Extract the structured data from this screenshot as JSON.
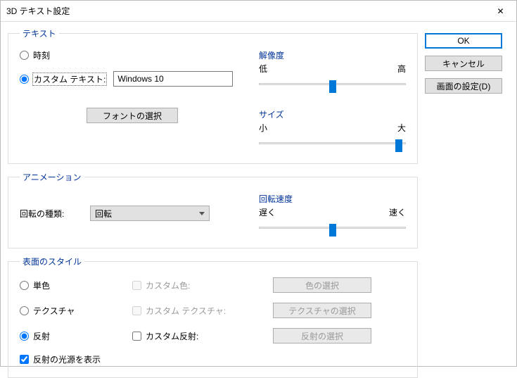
{
  "window": {
    "title": "3D テキスト設定"
  },
  "buttons": {
    "ok": "OK",
    "cancel": "キャンセル",
    "display": "画面の設定(D)"
  },
  "text_group": {
    "legend": "テキスト",
    "radio_time": "時刻",
    "radio_custom": "カスタム テキスト:",
    "custom_value": "Windows 10",
    "font_btn": "フォントの選択"
  },
  "sliders": {
    "resolution": {
      "title": "解像度",
      "low": "低",
      "high": "高",
      "value": 50
    },
    "size": {
      "title": "サイズ",
      "low": "小",
      "high": "大",
      "value": 95
    },
    "speed": {
      "title": "回転速度",
      "low": "遅く",
      "high": "速く",
      "value": 50
    }
  },
  "anim_group": {
    "legend": "アニメーション",
    "rotate_label": "回転の種類:",
    "rotate_value": "回転"
  },
  "style_group": {
    "legend": "表面のスタイル",
    "r_solid": "単色",
    "r_texture": "テクスチャ",
    "r_reflect": "反射",
    "c_color": "カスタム色:",
    "c_tex": "カスタム テクスチャ:",
    "c_ref": "カスタム反射:",
    "b_color": "色の選択",
    "b_tex": "テクスチャの選択",
    "b_ref": "反射の選択",
    "specular": "反射の光源を表示"
  }
}
